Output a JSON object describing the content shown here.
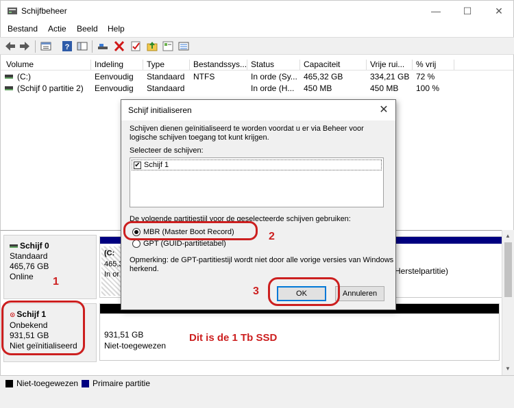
{
  "window": {
    "title": "Schijfbeheer",
    "minimize": "—",
    "maximize": "☐",
    "close": "✕"
  },
  "menu": [
    "Bestand",
    "Actie",
    "Beeld",
    "Help"
  ],
  "toolbar_icons": [
    "back-arrow-icon",
    "forward-arrow-icon",
    "properties-icon",
    "help-icon",
    "console-icon",
    "connect-icon",
    "delete-icon",
    "checklist-icon",
    "up-folder-icon",
    "export-list-icon"
  ],
  "volume_list": {
    "columns": [
      "Volume",
      "Indeling",
      "Type",
      "Bestandssys...",
      "Status",
      "Capaciteit",
      "Vrije rui...",
      "% vrij"
    ],
    "rows": [
      [
        "(C:)",
        "Eenvoudig",
        "Standaard",
        "NTFS",
        "In orde (Sy...",
        "465,32 GB",
        "334,21 GB",
        "72 %"
      ],
      [
        "(Schijf 0 partitie 2)",
        "Eenvoudig",
        "Standaard",
        "",
        "In orde (H...",
        "450 MB",
        "450 MB",
        "100 %"
      ]
    ]
  },
  "graphical": {
    "disk0": {
      "name": "Schijf 0",
      "type": "Standaard",
      "size": "465,76 GB",
      "status": "Online",
      "part_c_label": "(C:",
      "part_c_size": "465,3",
      "part_c_status": "In or",
      "recovery_text": "Herstelpartitie)"
    },
    "disk1": {
      "name": "Schijf 1",
      "type": "Onbekend",
      "size": "931,51 GB",
      "status": "Niet geïnitialiseerd",
      "space_size": "931,51 GB",
      "space_status": "Niet-toegewezen"
    }
  },
  "legend": [
    {
      "label": "Niet-toegewezen",
      "color": "#000000"
    },
    {
      "label": "Primaire partitie",
      "color": "#000080"
    }
  ],
  "dialog": {
    "title": "Schijf initialiseren",
    "intro_line1": "Schijven dienen geïnitialiseerd te worden voordat u er via Beheer voor",
    "intro_line2": "logische schijven toegang tot kunt krijgen.",
    "select_label": "Selecteer de schijven:",
    "disk_item": "Schijf 1",
    "disk_checked": "✔",
    "partition_label": "De volgende partitiestijl voor de geselecteerde schijven gebruiken:",
    "mbr": "MBR (Master Boot Record)",
    "gpt": "GPT (GUID-partitietabel)",
    "note_line1": "Opmerking: de GPT-partitiestijl wordt niet door alle vorige versies van Windows",
    "note_line2": "herkend.",
    "ok": "OK",
    "cancel": "Annuleren"
  },
  "annotations": {
    "n1": "1",
    "n2": "2",
    "n3": "3",
    "ssd_text": "Dit is de 1 Tb SSD",
    "color": "#cc1f1f"
  }
}
